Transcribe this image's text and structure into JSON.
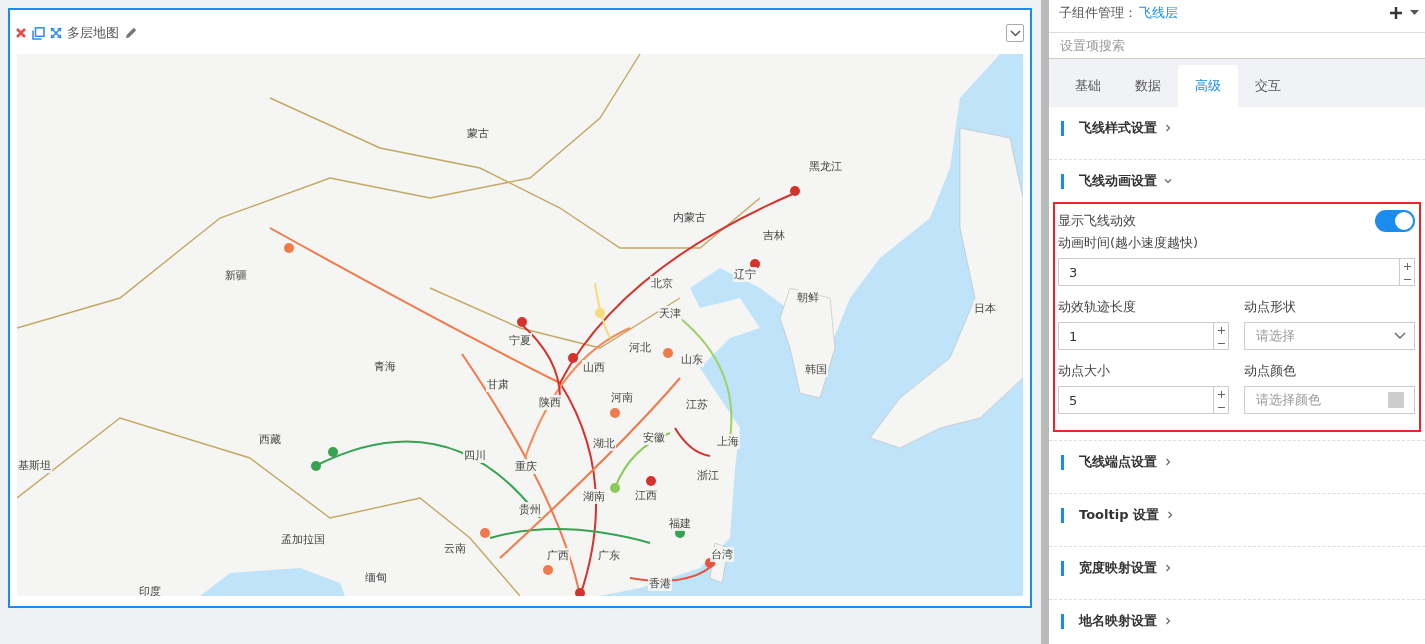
{
  "canvas": {
    "title": "多层地图",
    "map_labels": [
      "蒙古",
      "黑龙江",
      "内蒙古",
      "吉林",
      "新疆",
      "辽宁",
      "朝鲜",
      "日本",
      "北京",
      "天津",
      "宁夏",
      "山西",
      "河北",
      "山东",
      "青海",
      "甘肃",
      "陕西",
      "河南",
      "韩国",
      "江苏",
      "西藏",
      "四川",
      "湖北",
      "安徽",
      "上海",
      "重庆",
      "浙江",
      "江西",
      "湖南",
      "贵州",
      "福建",
      "云南",
      "广西",
      "广东",
      "台湾",
      "香港",
      "孟加拉国",
      "缅甸",
      "印度",
      "基斯坦"
    ]
  },
  "panel": {
    "header": {
      "label": "子组件管理：",
      "value": "飞线层"
    },
    "search": {
      "placeholder": "设置项搜索"
    },
    "tabs": [
      {
        "label": "基础",
        "selected": false
      },
      {
        "label": "数据",
        "selected": false
      },
      {
        "label": "高级",
        "selected": true
      },
      {
        "label": "交互",
        "selected": false
      }
    ],
    "sections": [
      {
        "title": "飞线样式设置",
        "expanded": false
      },
      {
        "title": "飞线动画设置",
        "expanded": true,
        "fields": [
          {
            "kind": "toggle",
            "label": "显示飞线动效",
            "on": true
          },
          {
            "kind": "number",
            "label": "动画时间(越小速度越快)",
            "value": "3"
          },
          {
            "kind": "number",
            "label": "动效轨迹长度",
            "value": "1"
          },
          {
            "kind": "select",
            "label": "动点形状",
            "placeholder": "请选择"
          },
          {
            "kind": "number",
            "label": "动点大小",
            "value": "5"
          },
          {
            "kind": "color",
            "label": "动点颜色",
            "placeholder": "请选择颜色"
          }
        ]
      },
      {
        "title": "飞线端点设置",
        "expanded": false
      },
      {
        "title": "Tooltip 设置",
        "expanded": false
      },
      {
        "title": "宽度映射设置",
        "expanded": false
      },
      {
        "title": "地名映射设置",
        "expanded": false
      }
    ]
  }
}
